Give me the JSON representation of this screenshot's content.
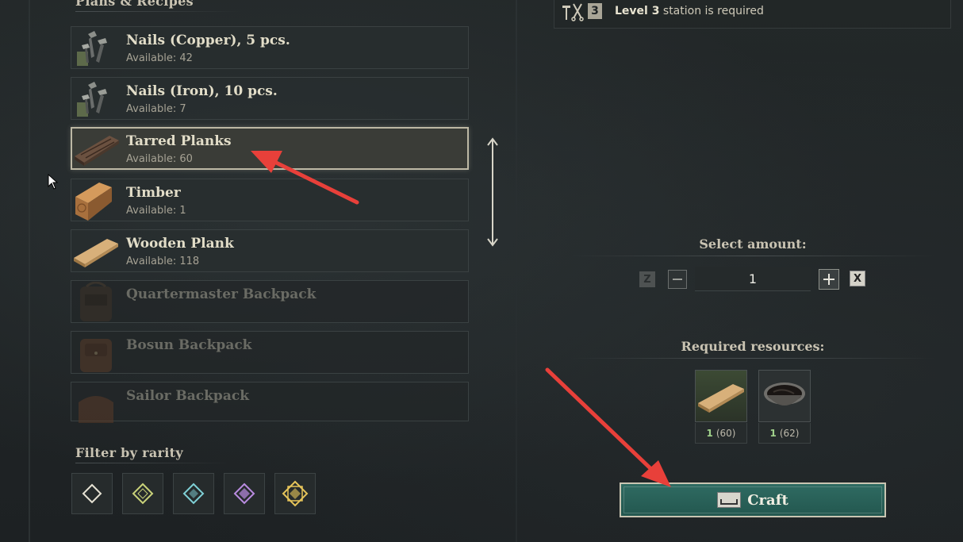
{
  "left_panel": {
    "section_title": "Plans & Recipes",
    "recipes": [
      {
        "name": "Nails (Copper), 5 pcs.",
        "available": "Available: 42",
        "icon": "copper-nails-icon",
        "state": "normal"
      },
      {
        "name": "Nails (Iron), 10 pcs.",
        "available": "Available: 7",
        "icon": "iron-nails-icon",
        "state": "normal"
      },
      {
        "name": "Tarred Planks",
        "available": "Available: 60",
        "icon": "tarred-planks-icon",
        "state": "selected"
      },
      {
        "name": "Timber",
        "available": "Available: 1",
        "icon": "timber-icon",
        "state": "normal"
      },
      {
        "name": "Wooden Plank",
        "available": "Available: 118",
        "icon": "wooden-plank-icon",
        "state": "normal"
      },
      {
        "name": "Quartermaster Backpack",
        "available": "",
        "icon": "backpack-icon",
        "state": "locked"
      },
      {
        "name": "Bosun Backpack",
        "available": "",
        "icon": "backpack-icon",
        "state": "locked"
      },
      {
        "name": "Sailor Backpack",
        "available": "",
        "icon": "backpack-icon",
        "state": "locked"
      }
    ],
    "filter_title": "Filter by rarity",
    "rarity_filters": [
      {
        "name": "common",
        "color": "#e6e2d4"
      },
      {
        "name": "uncommon",
        "color": "#c9d27a"
      },
      {
        "name": "rare",
        "color": "#7fd0d6"
      },
      {
        "name": "epic",
        "color": "#b98be0"
      },
      {
        "name": "legendary",
        "color": "#e6c45a"
      }
    ]
  },
  "right_panel": {
    "station": {
      "level_badge": "3",
      "text_bold": "Level 3",
      "text_rest": " station is required"
    },
    "select_amount_title": "Select amount:",
    "amount": {
      "key_decrease": "Z",
      "key_increase": "X",
      "value": "1"
    },
    "required_title": "Required resources:",
    "resources": [
      {
        "icon": "wooden-plank-icon",
        "need": "1",
        "have": "(60)"
      },
      {
        "icon": "tar-bowl-icon",
        "need": "1",
        "have": "(62)"
      }
    ],
    "craft_label": "Craft"
  },
  "colors": {
    "accent_teal": "#2a6259",
    "annotation_red": "#e8403a",
    "good_green": "#9fd08a"
  }
}
